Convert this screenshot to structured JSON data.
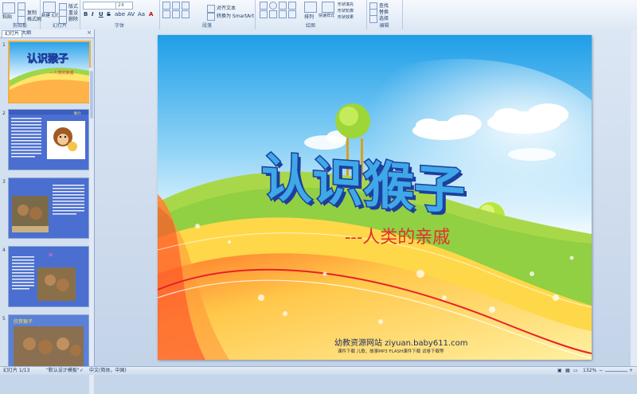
{
  "ribbon": {
    "clipboard": {
      "paste": "粘贴",
      "copy": "复制",
      "format_painter": "格式刷",
      "label": "剪贴板"
    },
    "slides": {
      "new_slide": "新建\n幻灯片",
      "layout": "版式",
      "reset": "重设",
      "delete": "删除",
      "label": "幻灯片"
    },
    "font": {
      "size": "24",
      "label": "字体",
      "bold": "B",
      "italic": "I",
      "underline": "U",
      "strike": "S",
      "shadow": "abe",
      "spacing": "AV",
      "case": "Aa",
      "color": "A"
    },
    "paragraph": {
      "align_text": "对齐文本",
      "convert_smartart": "转换为 SmartArt",
      "label": "段落"
    },
    "drawing": {
      "arrange": "排列",
      "quick_styles": "快速样式",
      "shape_fill": "形状填充",
      "shape_outline": "形状轮廓",
      "shape_effects": "形状效果",
      "label": "绘图"
    },
    "editing": {
      "find": "查找",
      "replace": "替换",
      "select": "选择",
      "label": "编辑"
    }
  },
  "panel": {
    "tabs": [
      "幻灯片",
      "大纲"
    ],
    "close": "×",
    "thumbs": [
      {
        "num": "1"
      },
      {
        "num": "2",
        "heading": "简介"
      },
      {
        "num": "3"
      },
      {
        "num": "4"
      },
      {
        "num": "5",
        "heading": "欣赏猴子"
      }
    ]
  },
  "slide": {
    "title": "认识猴子",
    "subtitle": "---人类的亲戚",
    "footer_site": "幼教资源网站 ziyuan.baby611.com",
    "footer_links": "课件下载   儿歌、故事MP3   FLASH课件下载   试卷下载等"
  },
  "status": {
    "slide_pos": "幻灯片 1/13",
    "theme": "\"默认设计模板\"",
    "lang": "中文(简体，中国)",
    "zoom": "132%"
  },
  "colors": {
    "title_fill": "#3fa8e8",
    "title_outline": "#1d3f9e",
    "subtitle": "#e03030",
    "sky_top": "#1e9ee8"
  }
}
